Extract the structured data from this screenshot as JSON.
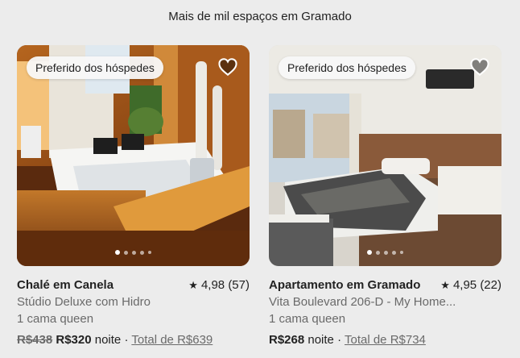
{
  "header": {
    "title": "Mais de mil espaços em Gramado"
  },
  "listings": [
    {
      "badge": "Preferido dos hóspedes",
      "heart_icon": "heart-outline-icon",
      "title": "Chalé em Canela",
      "rating_icon": "star-icon",
      "rating": "4,98 (57)",
      "subtitle": "Stúdio Deluxe com Hidro",
      "beds": "1 cama queen",
      "price_old": "R$438",
      "price_new": "R$320",
      "price_unit": "noite",
      "separator": "·",
      "total": "Total de R$639",
      "carousel": {
        "dots": 5,
        "active": 0
      }
    },
    {
      "badge": "Preferido dos hóspedes",
      "heart_icon": "heart-outline-icon",
      "title": "Apartamento em Gramado",
      "rating_icon": "star-icon",
      "rating": "4,95 (22)",
      "subtitle": "Vita Boulevard 206-D - My Home...",
      "beds": "1 cama queen",
      "price_old": "",
      "price_new": "R$268",
      "price_unit": "noite",
      "separator": "·",
      "total": "Total de R$734",
      "carousel": {
        "dots": 5,
        "active": 0
      }
    }
  ]
}
